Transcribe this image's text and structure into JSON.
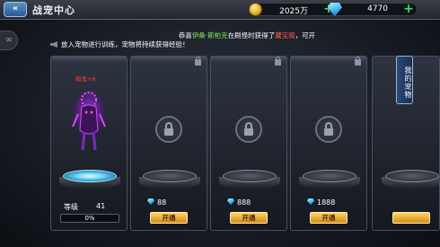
{
  "header": {
    "back_icon": "«",
    "title": "战宠中心",
    "gold": "2025万",
    "gems": "4770",
    "plus": "+"
  },
  "left_tab": {
    "icon": "∞"
  },
  "notice": {
    "prefix": "恭喜",
    "player": "伊桑·斯帕克",
    "middle": "在刷怪时获得了",
    "item": "藏宝阁",
    "suffix": "，可开"
  },
  "hint": "放入宠物进行训练，宠物将持续获得经验！",
  "my_pet_tab": "我的宠物",
  "slots": [
    {
      "pet_name": "暗鬼+6",
      "level_label": "等级",
      "level": "41",
      "exp_text": "0%",
      "exp_fraction": 0.0
    },
    {
      "price": "88",
      "button": "开通"
    },
    {
      "price": "888",
      "button": "开通"
    },
    {
      "price": "1888",
      "button": "开通"
    }
  ],
  "colors": {
    "accent_gold": "#e0a81e",
    "button_orange": "#d98b12",
    "gem_blue": "#3ab2ef",
    "pet_name_red": "#ff3c3c",
    "notice_green": "#7ee35a",
    "notice_red": "#ff5b4a"
  }
}
